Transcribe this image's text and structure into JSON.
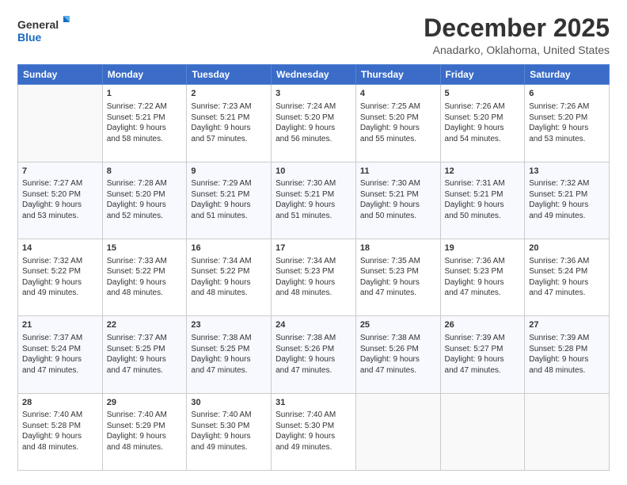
{
  "header": {
    "logo_line1": "General",
    "logo_line2": "Blue",
    "title": "December 2025",
    "subtitle": "Anadarko, Oklahoma, United States"
  },
  "calendar": {
    "days_of_week": [
      "Sunday",
      "Monday",
      "Tuesday",
      "Wednesday",
      "Thursday",
      "Friday",
      "Saturday"
    ],
    "weeks": [
      [
        {
          "day": "",
          "content": ""
        },
        {
          "day": "1",
          "content": "Sunrise: 7:22 AM\nSunset: 5:21 PM\nDaylight: 9 hours\nand 58 minutes."
        },
        {
          "day": "2",
          "content": "Sunrise: 7:23 AM\nSunset: 5:21 PM\nDaylight: 9 hours\nand 57 minutes."
        },
        {
          "day": "3",
          "content": "Sunrise: 7:24 AM\nSunset: 5:20 PM\nDaylight: 9 hours\nand 56 minutes."
        },
        {
          "day": "4",
          "content": "Sunrise: 7:25 AM\nSunset: 5:20 PM\nDaylight: 9 hours\nand 55 minutes."
        },
        {
          "day": "5",
          "content": "Sunrise: 7:26 AM\nSunset: 5:20 PM\nDaylight: 9 hours\nand 54 minutes."
        },
        {
          "day": "6",
          "content": "Sunrise: 7:26 AM\nSunset: 5:20 PM\nDaylight: 9 hours\nand 53 minutes."
        }
      ],
      [
        {
          "day": "7",
          "content": "Sunrise: 7:27 AM\nSunset: 5:20 PM\nDaylight: 9 hours\nand 53 minutes."
        },
        {
          "day": "8",
          "content": "Sunrise: 7:28 AM\nSunset: 5:20 PM\nDaylight: 9 hours\nand 52 minutes."
        },
        {
          "day": "9",
          "content": "Sunrise: 7:29 AM\nSunset: 5:21 PM\nDaylight: 9 hours\nand 51 minutes."
        },
        {
          "day": "10",
          "content": "Sunrise: 7:30 AM\nSunset: 5:21 PM\nDaylight: 9 hours\nand 51 minutes."
        },
        {
          "day": "11",
          "content": "Sunrise: 7:30 AM\nSunset: 5:21 PM\nDaylight: 9 hours\nand 50 minutes."
        },
        {
          "day": "12",
          "content": "Sunrise: 7:31 AM\nSunset: 5:21 PM\nDaylight: 9 hours\nand 50 minutes."
        },
        {
          "day": "13",
          "content": "Sunrise: 7:32 AM\nSunset: 5:21 PM\nDaylight: 9 hours\nand 49 minutes."
        }
      ],
      [
        {
          "day": "14",
          "content": "Sunrise: 7:32 AM\nSunset: 5:22 PM\nDaylight: 9 hours\nand 49 minutes."
        },
        {
          "day": "15",
          "content": "Sunrise: 7:33 AM\nSunset: 5:22 PM\nDaylight: 9 hours\nand 48 minutes."
        },
        {
          "day": "16",
          "content": "Sunrise: 7:34 AM\nSunset: 5:22 PM\nDaylight: 9 hours\nand 48 minutes."
        },
        {
          "day": "17",
          "content": "Sunrise: 7:34 AM\nSunset: 5:23 PM\nDaylight: 9 hours\nand 48 minutes."
        },
        {
          "day": "18",
          "content": "Sunrise: 7:35 AM\nSunset: 5:23 PM\nDaylight: 9 hours\nand 47 minutes."
        },
        {
          "day": "19",
          "content": "Sunrise: 7:36 AM\nSunset: 5:23 PM\nDaylight: 9 hours\nand 47 minutes."
        },
        {
          "day": "20",
          "content": "Sunrise: 7:36 AM\nSunset: 5:24 PM\nDaylight: 9 hours\nand 47 minutes."
        }
      ],
      [
        {
          "day": "21",
          "content": "Sunrise: 7:37 AM\nSunset: 5:24 PM\nDaylight: 9 hours\nand 47 minutes."
        },
        {
          "day": "22",
          "content": "Sunrise: 7:37 AM\nSunset: 5:25 PM\nDaylight: 9 hours\nand 47 minutes."
        },
        {
          "day": "23",
          "content": "Sunrise: 7:38 AM\nSunset: 5:25 PM\nDaylight: 9 hours\nand 47 minutes."
        },
        {
          "day": "24",
          "content": "Sunrise: 7:38 AM\nSunset: 5:26 PM\nDaylight: 9 hours\nand 47 minutes."
        },
        {
          "day": "25",
          "content": "Sunrise: 7:38 AM\nSunset: 5:26 PM\nDaylight: 9 hours\nand 47 minutes."
        },
        {
          "day": "26",
          "content": "Sunrise: 7:39 AM\nSunset: 5:27 PM\nDaylight: 9 hours\nand 47 minutes."
        },
        {
          "day": "27",
          "content": "Sunrise: 7:39 AM\nSunset: 5:28 PM\nDaylight: 9 hours\nand 48 minutes."
        }
      ],
      [
        {
          "day": "28",
          "content": "Sunrise: 7:40 AM\nSunset: 5:28 PM\nDaylight: 9 hours\nand 48 minutes."
        },
        {
          "day": "29",
          "content": "Sunrise: 7:40 AM\nSunset: 5:29 PM\nDaylight: 9 hours\nand 48 minutes."
        },
        {
          "day": "30",
          "content": "Sunrise: 7:40 AM\nSunset: 5:30 PM\nDaylight: 9 hours\nand 49 minutes."
        },
        {
          "day": "31",
          "content": "Sunrise: 7:40 AM\nSunset: 5:30 PM\nDaylight: 9 hours\nand 49 minutes."
        },
        {
          "day": "",
          "content": ""
        },
        {
          "day": "",
          "content": ""
        },
        {
          "day": "",
          "content": ""
        }
      ]
    ]
  }
}
